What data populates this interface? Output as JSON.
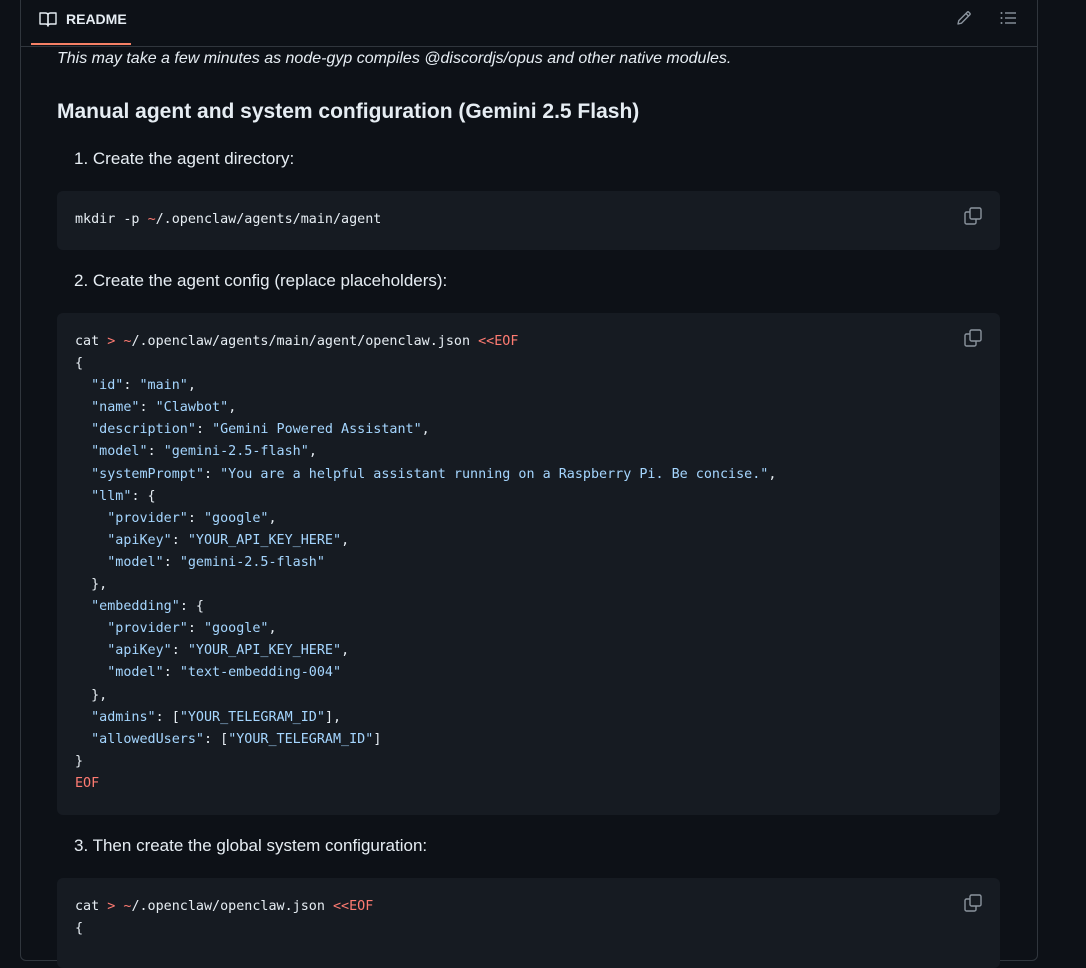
{
  "header": {
    "tab_label": "README",
    "icons": [
      "book-icon",
      "pencil-icon",
      "list-icon"
    ]
  },
  "content": {
    "note": "This may take a few minutes as node-gyp compiles @discordjs/opus and other native modules.",
    "heading": "Manual agent and system configuration (Gemini 2.5 Flash)",
    "steps": [
      "1. Create the agent directory:",
      "2. Create the agent config (replace placeholders):",
      "3. Then create the global system configuration:"
    ],
    "code_blocks": [
      {
        "lines": [
          "mkdir -p ~/.openclaw/agents/main/agent"
        ]
      },
      {
        "lines": [
          "cat > ~/.openclaw/agents/main/agent/openclaw.json <<EOF",
          "{",
          "  \"id\": \"main\",",
          "  \"name\": \"Clawbot\",",
          "  \"description\": \"Gemini Powered Assistant\",",
          "  \"model\": \"gemini-2.5-flash\",",
          "  \"systemPrompt\": \"You are a helpful assistant running on a Raspberry Pi. Be concise.\",",
          "  \"llm\": {",
          "    \"provider\": \"google\",",
          "    \"apiKey\": \"YOUR_API_KEY_HERE\",",
          "    \"model\": \"gemini-2.5-flash\"",
          "  },",
          "  \"embedding\": {",
          "    \"provider\": \"google\",",
          "    \"apiKey\": \"YOUR_API_KEY_HERE\",",
          "    \"model\": \"text-embedding-004\"",
          "  },",
          "  \"admins\": [\"YOUR_TELEGRAM_ID\"],",
          "  \"allowedUsers\": [\"YOUR_TELEGRAM_ID\"]",
          "}",
          "EOF"
        ]
      },
      {
        "lines": [
          "cat > ~/.openclaw/openclaw.json <<EOF",
          "{"
        ]
      }
    ]
  },
  "colors": {
    "background": "#0d1117",
    "code_background": "#161b22",
    "border": "#30363d",
    "text": "#e6edf3",
    "string": "#a5d6ff",
    "operator": "#ff7b72",
    "tab_underline": "#f78166"
  }
}
